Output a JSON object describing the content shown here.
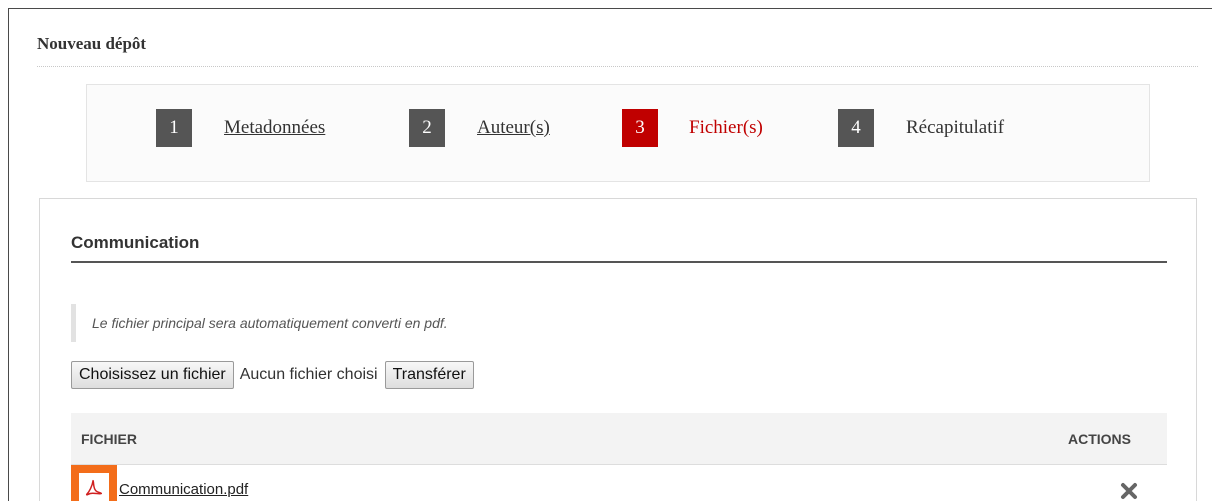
{
  "header": {
    "title": "Nouveau dépôt"
  },
  "steps": [
    {
      "num": "1",
      "label": "Metadonnées"
    },
    {
      "num": "2",
      "label": "Auteur(s)"
    },
    {
      "num": "3",
      "label": "Fichier(s)"
    },
    {
      "num": "4",
      "label": "Récapitulatif"
    }
  ],
  "colors": {
    "active_step": "#c00000",
    "inactive_step": "#555555",
    "pdf_highlight": "#f36d1a"
  },
  "section": {
    "title": "Communication",
    "notice": "Le fichier principal sera automatiquement converti en pdf.",
    "choose_button": "Choisissez un fichier",
    "no_file_text": "Aucun fichier choisi",
    "upload_button": "Transférer"
  },
  "table": {
    "col_file": "FICHIER",
    "col_actions": "ACTIONS",
    "rows": [
      {
        "icon": "pdf-icon",
        "filename": "Communication.pdf",
        "action_icon": "delete-icon"
      }
    ]
  }
}
